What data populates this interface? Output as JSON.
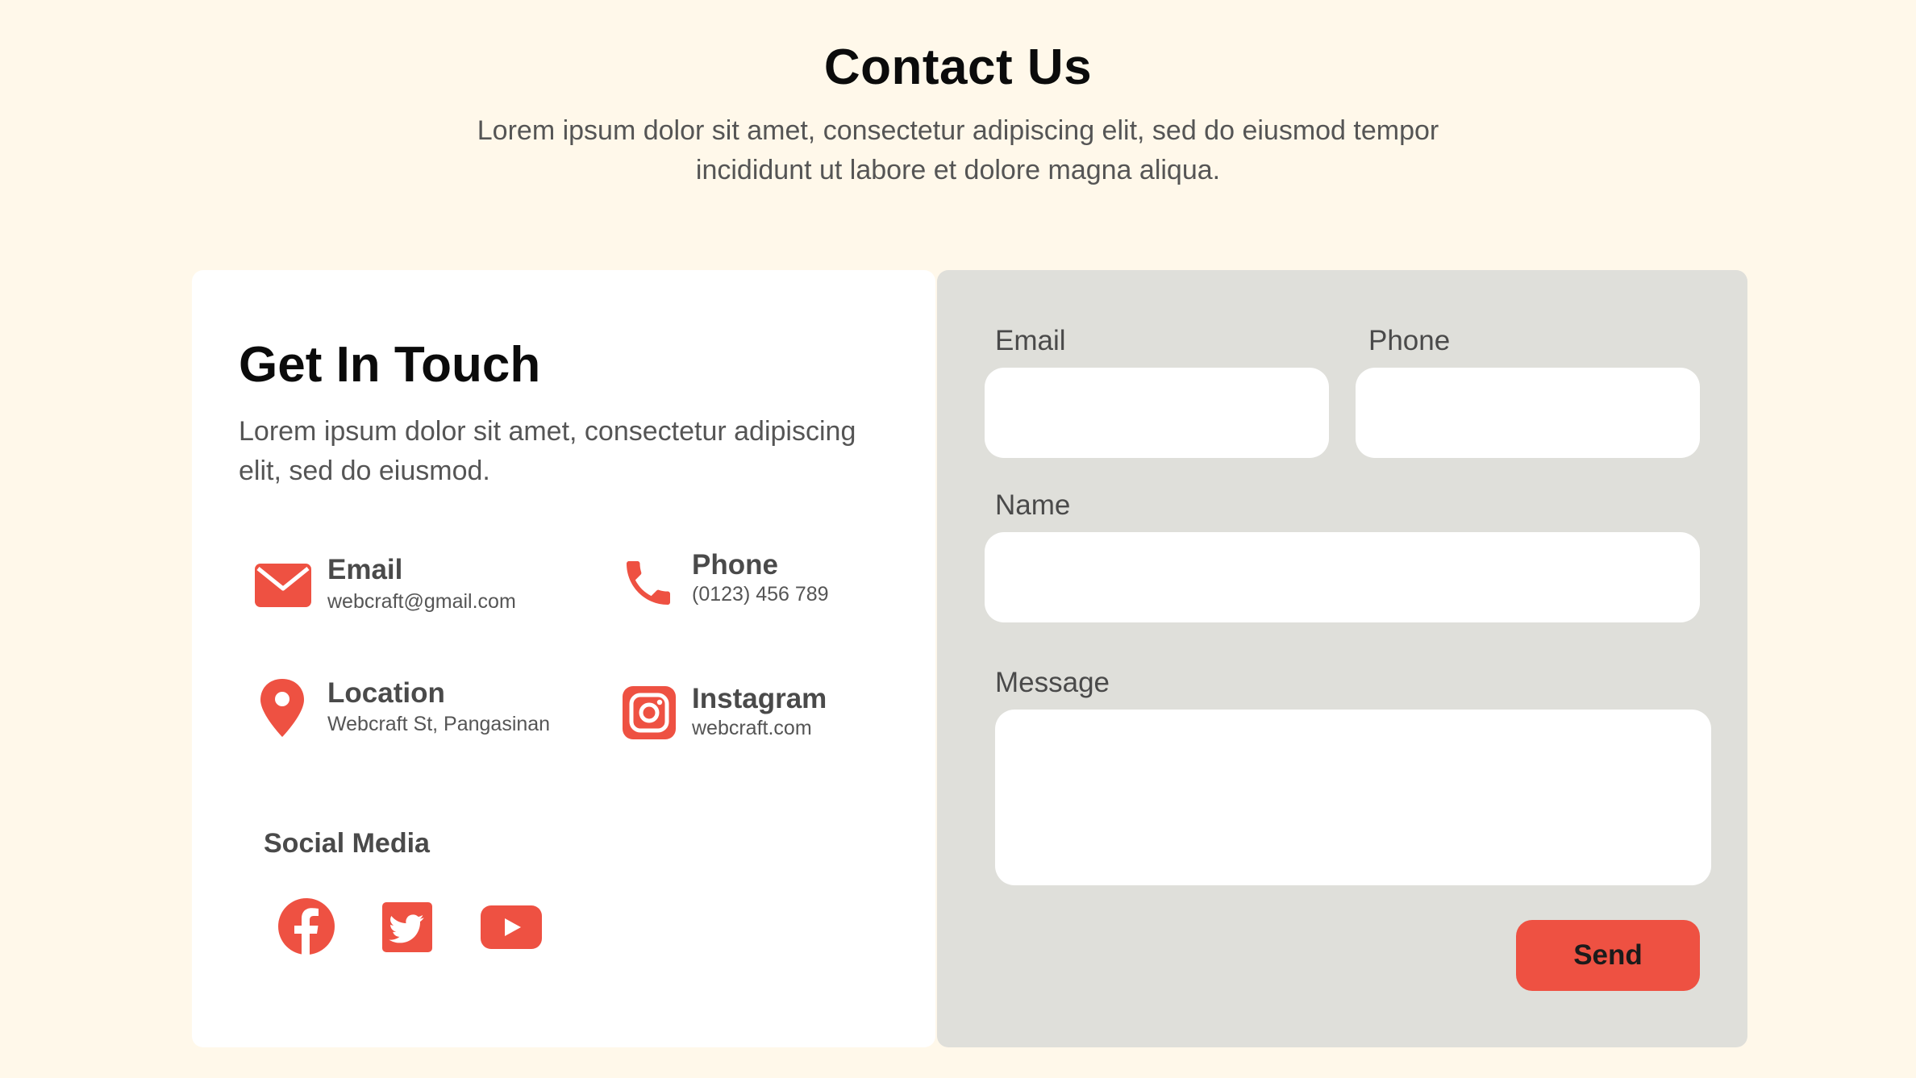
{
  "header": {
    "title": "Contact Us",
    "subtitle": "Lorem ipsum dolor sit amet, consectetur adipiscing elit, sed do eiusmod tempor incididunt ut labore et dolore magna aliqua."
  },
  "info": {
    "title": "Get In Touch",
    "description": "Lorem ipsum dolor sit amet, consectetur adipiscing elit, sed do eiusmod.",
    "items": [
      {
        "icon": "envelope-icon",
        "label": "Email",
        "value": "webcraft@gmail.com"
      },
      {
        "icon": "phone-icon",
        "label": "Phone",
        "value": "(0123) 456 789"
      },
      {
        "icon": "location-pin-icon",
        "label": "Location",
        "value": "Webcraft St, Pangasinan"
      },
      {
        "icon": "instagram-icon",
        "label": "Instagram",
        "value": "webcraft.com"
      }
    ],
    "social": {
      "title": "Social Media",
      "icons": [
        "facebook-icon",
        "twitter-icon",
        "youtube-icon"
      ]
    }
  },
  "form": {
    "email_label": "Email",
    "phone_label": "Phone",
    "name_label": "Name",
    "message_label": "Message",
    "email_value": "",
    "phone_value": "",
    "name_value": "",
    "message_value": "",
    "send_label": "Send"
  },
  "colors": {
    "page_background": "#fff8ea",
    "accent": "#ee5142",
    "card_background": "#ffffff",
    "form_background": "#dfdfda"
  }
}
